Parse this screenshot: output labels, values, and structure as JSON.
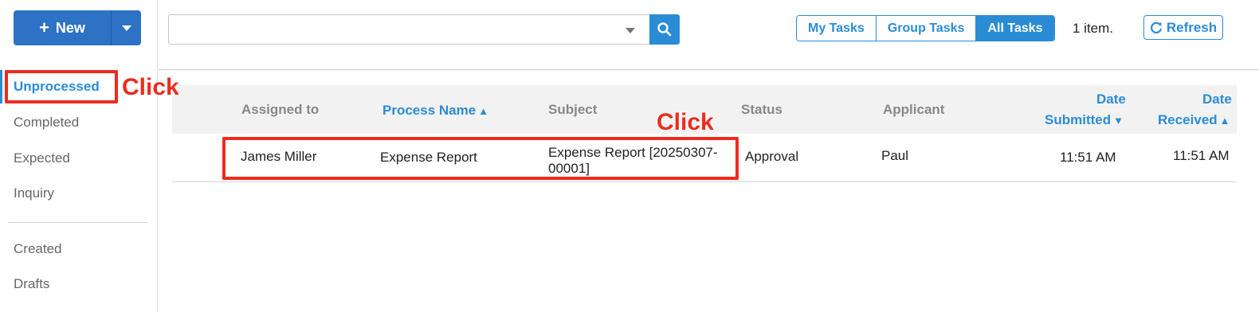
{
  "sidebar": {
    "new_button_label": "New",
    "nav": [
      {
        "label": "Unprocessed"
      },
      {
        "label": "Completed"
      },
      {
        "label": "Expected"
      },
      {
        "label": "Inquiry"
      },
      {
        "label": "Created"
      },
      {
        "label": "Drafts"
      }
    ]
  },
  "toolbar": {
    "search_value": "",
    "tabs": [
      {
        "label": "My Tasks"
      },
      {
        "label": "Group Tasks"
      },
      {
        "label": "All Tasks"
      }
    ],
    "active_tab": "All Tasks",
    "item_count": "1 item.",
    "refresh_label": "Refresh"
  },
  "table": {
    "headers": {
      "assigned_to": "Assigned to",
      "process_name": "Process Name",
      "subject": "Subject",
      "status": "Status",
      "applicant": "Applicant",
      "date_submitted_1": "Date",
      "date_submitted_2": "Submitted",
      "date_received_1": "Date",
      "date_received_2": "Received"
    },
    "rows": [
      {
        "assigned_to": "James Miller",
        "process_name": "Expense Report",
        "subject_1": "Expense Report [20250307-",
        "subject_2": "00001]",
        "status": "Approval",
        "applicant": "Paul",
        "date_submitted": "11:51 AM",
        "date_received": "11:51 AM"
      }
    ]
  },
  "annotations": {
    "click_label_1": "Click",
    "click_label_2": "Click"
  },
  "colors": {
    "primary": "#2d72c4",
    "accent": "#2b8cd6",
    "highlight": "#ee2b1d"
  }
}
